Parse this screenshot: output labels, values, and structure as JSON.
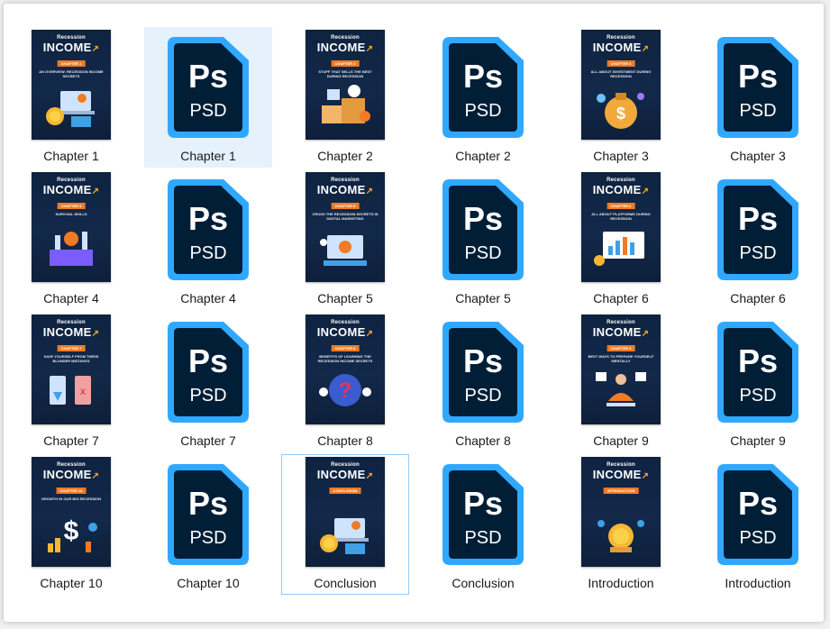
{
  "items": [
    {
      "label": "Chapter 1",
      "type": "cover",
      "cover": {
        "brand_small": "Recession",
        "brand_big": "INCOME",
        "tag": "CHAPTER 1",
        "sub": "AN OVERVIEW: RECESSION INCOME SECRETS",
        "art": "coins-laptop"
      }
    },
    {
      "label": "Chapter 1",
      "type": "psd",
      "selected": true
    },
    {
      "label": "Chapter 2",
      "type": "cover",
      "cover": {
        "brand_small": "Recession",
        "brand_big": "INCOME",
        "tag": "CHAPTER 2",
        "sub": "STUFF THAT SELLS THE BEST DURING RECESSION",
        "art": "boxes"
      }
    },
    {
      "label": "Chapter 2",
      "type": "psd"
    },
    {
      "label": "Chapter 3",
      "type": "cover",
      "cover": {
        "brand_small": "Recession",
        "brand_big": "INCOME",
        "tag": "CHAPTER 3",
        "sub": "ALL ABOUT INVESTMENT DURING RECESSION",
        "art": "money-bag"
      }
    },
    {
      "label": "Chapter 3",
      "type": "psd"
    },
    {
      "label": "Chapter 4",
      "type": "cover",
      "cover": {
        "brand_small": "Recession",
        "brand_big": "INCOME",
        "tag": "CHAPTER 4",
        "sub": "SURVIVAL SKILLS",
        "art": "skills"
      }
    },
    {
      "label": "Chapter 4",
      "type": "psd"
    },
    {
      "label": "Chapter 5",
      "type": "cover",
      "cover": {
        "brand_small": "Recession",
        "brand_big": "INCOME",
        "tag": "CHAPTER 5",
        "sub": "CRUSH THE RECESSION SECRETS IN DIGITAL MARKETING",
        "art": "digital"
      }
    },
    {
      "label": "Chapter 5",
      "type": "psd"
    },
    {
      "label": "Chapter 6",
      "type": "cover",
      "cover": {
        "brand_small": "Recession",
        "brand_big": "INCOME",
        "tag": "CHAPTER 6",
        "sub": "ALL ABOUT PLATFORMS DURING RECESSION",
        "art": "dashboard"
      }
    },
    {
      "label": "Chapter 6",
      "type": "psd"
    },
    {
      "label": "Chapter 7",
      "type": "cover",
      "cover": {
        "brand_small": "Recession",
        "brand_big": "INCOME",
        "tag": "CHAPTER 7",
        "sub": "SAVE YOURSELF FROM THESE BLUNDER MISTAKES",
        "art": "phones"
      }
    },
    {
      "label": "Chapter 7",
      "type": "psd"
    },
    {
      "label": "Chapter 8",
      "type": "cover",
      "cover": {
        "brand_small": "Recession",
        "brand_big": "INCOME",
        "tag": "CHAPTER 8",
        "sub": "BENEFITS OF LEARNING THE RECESSION INCOME SECRETS",
        "art": "question"
      }
    },
    {
      "label": "Chapter 8",
      "type": "psd"
    },
    {
      "label": "Chapter 9",
      "type": "cover",
      "cover": {
        "brand_small": "Recession",
        "brand_big": "INCOME",
        "tag": "CHAPTER 9",
        "sub": "BEST WAYS TO PREPARE YOURSELF MENTALLY",
        "art": "meditate"
      }
    },
    {
      "label": "Chapter 9",
      "type": "psd"
    },
    {
      "label": "Chapter 10",
      "type": "cover",
      "cover": {
        "brand_small": "Recession",
        "brand_big": "INCOME",
        "tag": "CHAPTER 10",
        "sub": "GROWTH IN OUR BIG RECESSION",
        "art": "dollar"
      }
    },
    {
      "label": "Chapter 10",
      "type": "psd"
    },
    {
      "label": "Conclusion",
      "type": "cover",
      "focused": true,
      "cover": {
        "brand_small": "Recession",
        "brand_big": "INCOME",
        "tag": "CONCLUSION",
        "sub": "",
        "art": "coins-laptop"
      }
    },
    {
      "label": "Conclusion",
      "type": "psd"
    },
    {
      "label": "Introduction",
      "type": "cover",
      "cover": {
        "brand_small": "Recession",
        "brand_big": "INCOME",
        "tag": "INTRODUCTION",
        "sub": "",
        "art": "coins"
      }
    },
    {
      "label": "Introduction",
      "type": "psd"
    }
  ],
  "psd": {
    "badge": "Ps",
    "ext": "PSD",
    "color_frame": "#31a8ff",
    "color_body": "#001e36"
  },
  "colors": {
    "selected_bg": "#e5f1fb",
    "focus_border": "#99c9ef",
    "cover_tag": "#f07b24"
  }
}
